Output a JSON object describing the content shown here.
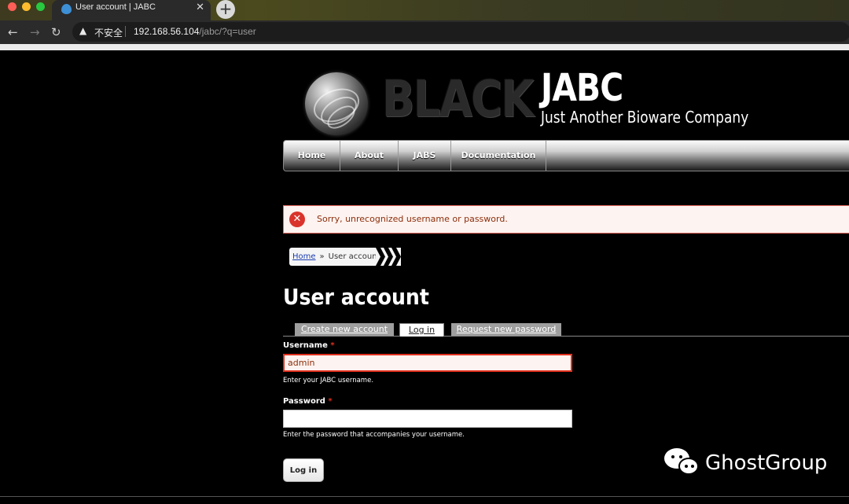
{
  "browser": {
    "tab_title": "User account | JABC",
    "tab_close": "✕",
    "new_tab": "+",
    "security_label": "不安全",
    "url_host": "192.168.56.104",
    "url_path": "/jabc/?q=user"
  },
  "header": {
    "logo_text": "BLACK",
    "site_name": "JABC",
    "site_slogan": "Just Another Bioware Company"
  },
  "menu": {
    "items": [
      "Home",
      "About",
      "JABS",
      "Documentation"
    ]
  },
  "messages": {
    "error": "Sorry, unrecognized username or password."
  },
  "breadcrumb": {
    "home": "Home",
    "separator": "»",
    "current": "User account"
  },
  "main": {
    "title": "User account",
    "tabs": [
      "Create new account",
      "Log in",
      "Request new password"
    ],
    "active_tab": "Log in"
  },
  "form": {
    "username_label": "Username",
    "username_value": "admin",
    "username_description": "Enter your JABC username.",
    "password_label": "Password",
    "password_value": "",
    "password_description": "Enter the password that accompanies your username.",
    "required_marker": "*",
    "submit_label": "Log in"
  },
  "watermark": {
    "text": "GhostGroup"
  },
  "colors": {
    "error_border": "#e4685d",
    "error_text": "#8c2e0b",
    "link": "#1a3caf",
    "page_bg": "#000000"
  }
}
